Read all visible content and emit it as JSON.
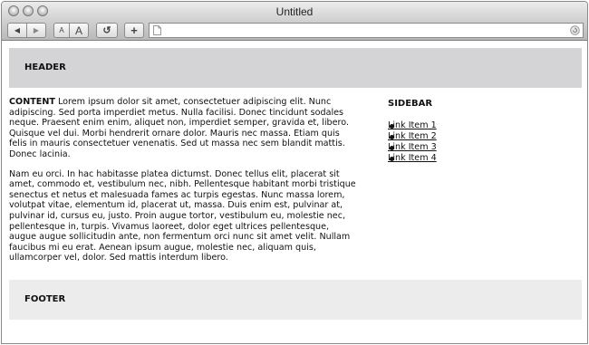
{
  "window": {
    "title": "Untitled"
  },
  "toolbar": {
    "back_glyph": "◀",
    "forward_glyph": "▶",
    "text_smaller_label": "A",
    "text_larger_label": "A",
    "reload_glyph": "↺",
    "add_glyph": "+",
    "url_value": "",
    "icons": {
      "back": "back-arrow-icon",
      "forward": "forward-arrow-icon",
      "reload": "reload-icon",
      "add": "add-bookmark-icon",
      "page": "page-icon",
      "go": "go-icon"
    }
  },
  "page": {
    "header_label": "HEADER",
    "content": {
      "lead": "CONTENT",
      "paragraph1": "Lorem ipsum dolor sit amet, consectetuer adipiscing elit. Nunc adipiscing. Sed porta imperdiet metus. Nulla facilisi. Donec tincidunt sodales neque. Praesent enim enim, aliquet non, imperdiet semper, gravida et, libero. Quisque vel dui. Morbi hendrerit ornare dolor. Mauris nec massa. Etiam quis felis in mauris consectetuer venenatis. Sed ut massa nec sem blandit mattis. Donec lacinia.",
      "paragraph2": "Nam eu orci. In hac habitasse platea dictumst. Donec tellus elit, placerat sit amet, commodo et, vestibulum nec, nibh. Pellentesque habitant morbi tristique senectus et netus et malesuada fames ac turpis egestas. Nunc massa lorem, volutpat vitae, elementum id, placerat ut, massa. Duis enim est, pulvinar at, pulvinar id, cursus eu, justo. Proin augue tortor, vestibulum eu, molestie nec, pellentesque in, turpis. Vivamus laoreet, dolor eget ultrices pellentesque, augue augue sollicitudin ante, non fermentum orci nunc sit amet velit. Nullam faucibus mi eu erat. Aenean ipsum augue, molestie nec, aliquam quis, ullamcorper vel, dolor. Sed mattis interdum libero."
    },
    "sidebar": {
      "heading": "SIDEBAR",
      "links": [
        "Link Item 1",
        "Link Item 2",
        "Link Item 3",
        "Link Item 4"
      ]
    },
    "footer_label": "FOOTER"
  },
  "colors": {
    "header_bg": "#d4d4d7",
    "footer_bg": "#ececec",
    "chrome_bg": "#cfcfcf"
  }
}
